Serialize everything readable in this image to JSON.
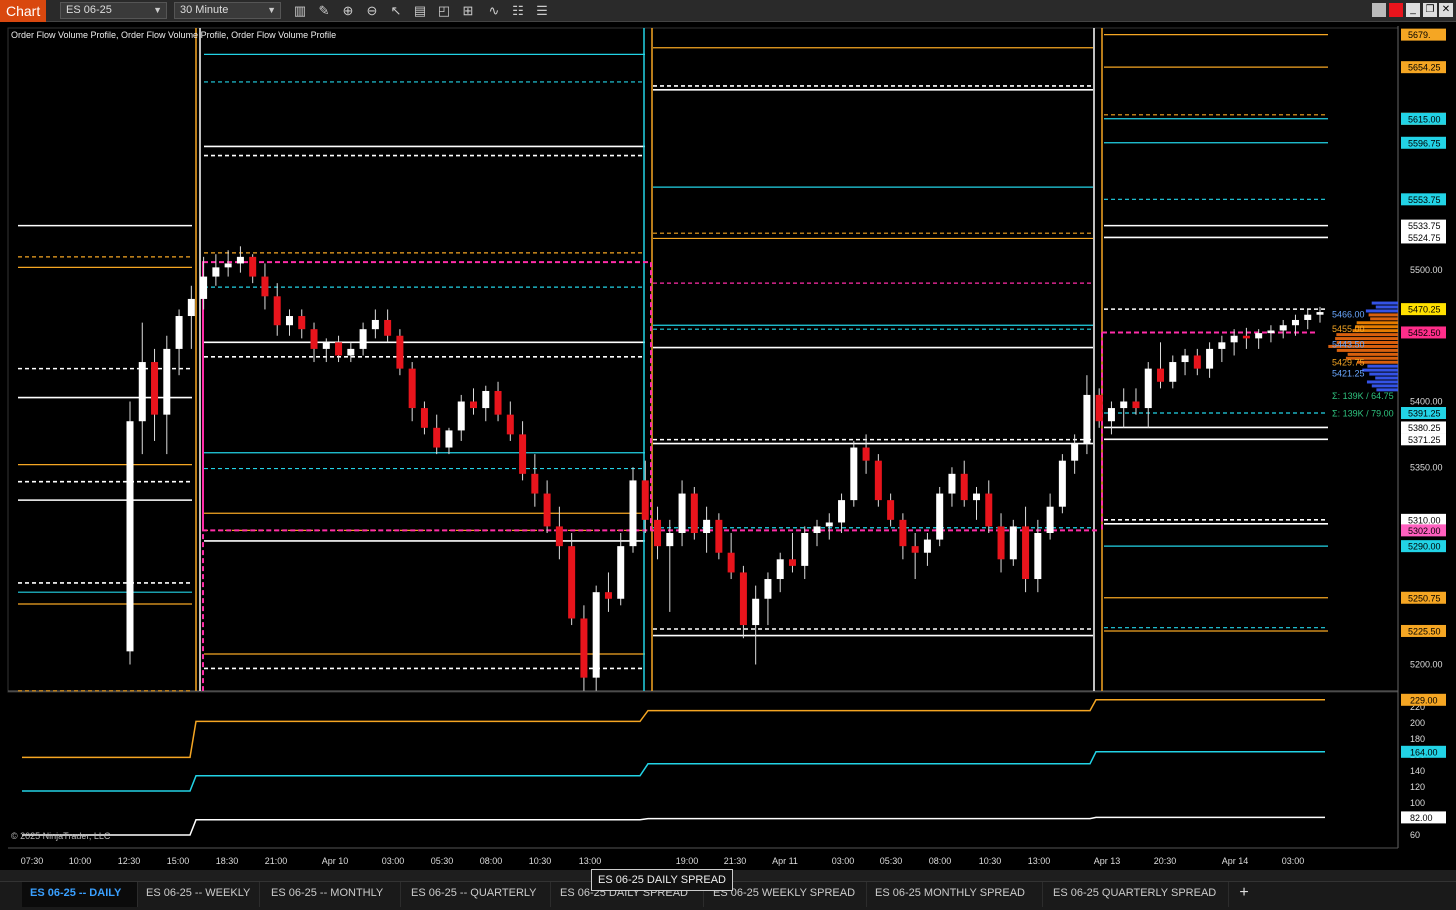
{
  "toolbar": {
    "title": "Chart",
    "instrument": "ES 06-25",
    "interval": "30 Minute",
    "icons": [
      "bar-type-icon",
      "draw-pencil-icon",
      "zoom-in-icon",
      "zoom-out-icon",
      "pointer-icon",
      "data-box-icon",
      "templates-icon",
      "strategies-icon",
      "indicators-icon",
      "properties-icon",
      "list-icon"
    ]
  },
  "indicator_label": "Order Flow Volume Profile, Order Flow Volume Profile, Order Flow Volume Profile",
  "copyright": "© 2025 NinjaTrader, LLC",
  "price_labels": [
    {
      "text": "5679.",
      "value": 5679,
      "color": "#f5a623"
    },
    {
      "text": "5654.25",
      "value": 5654.25,
      "color": "#f5a623"
    },
    {
      "text": "5615.00",
      "value": 5615,
      "color": "#f5a623"
    },
    {
      "text": "5615.00",
      "value": 5615,
      "color": "#22d3e6"
    },
    {
      "text": "5596.75",
      "value": 5596.75,
      "color": "#22d3e6"
    },
    {
      "text": "5553.75",
      "value": 5553.75,
      "color": "#22d3e6"
    },
    {
      "text": "5533.75",
      "value": 5533.75,
      "color": "#ffffff"
    },
    {
      "text": "5524.75",
      "value": 5524.75,
      "color": "#ffffff"
    },
    {
      "text": "5470.25",
      "value": 5470.25,
      "color": "#ffe000"
    },
    {
      "text": "5452.50",
      "value": 5452.5,
      "color": "#ff2d8a"
    },
    {
      "text": "5391.25",
      "value": 5391.25,
      "color": "#22d3e6"
    },
    {
      "text": "5380.25",
      "value": 5380.25,
      "color": "#ffffff"
    },
    {
      "text": "5371.25",
      "value": 5371.25,
      "color": "#ffffff"
    },
    {
      "text": "5310.00",
      "value": 5310,
      "color": "#ffffff"
    },
    {
      "text": "5302.00",
      "value": 5302,
      "color": "#ff5fbf"
    },
    {
      "text": "5290.00",
      "value": 5290,
      "color": "#22d3e6"
    },
    {
      "text": "5250.75",
      "value": 5250.75,
      "color": "#f5a623"
    },
    {
      "text": "5225.50",
      "value": 5225.5,
      "color": "#f5a623"
    }
  ],
  "price_ticks": [
    "5500.00",
    "5450.00",
    "5400.00",
    "5350.00",
    "5200.00"
  ],
  "profile_labels": [
    {
      "text": "5466.00",
      "color": "#6aa8ff"
    },
    {
      "text": "5455.00",
      "color": "#f5a623"
    },
    {
      "text": "5443.50",
      "color": "#6aa8ff"
    },
    {
      "text": "5429.75",
      "color": "#f5a623"
    },
    {
      "text": "5421.25",
      "color": "#6aa8ff"
    },
    {
      "text": "Σ: 139K / 64.75",
      "color": "#2ec27e"
    },
    {
      "text": "Σ: 139K / 79.00",
      "color": "#2ec27e"
    }
  ],
  "lower_panel": {
    "labels": [
      {
        "text": "229.00",
        "value": 229,
        "color": "#f5a623"
      },
      {
        "text": "164.00",
        "value": 164,
        "color": "#22d3e6"
      },
      {
        "text": "82.00",
        "value": 82,
        "color": "#ffffff"
      }
    ],
    "ticks": [
      "220",
      "200",
      "180",
      "160",
      "140",
      "120",
      "100",
      "80",
      "60"
    ]
  },
  "time_axis": [
    "07:30",
    "10:00",
    "12:30",
    "15:00",
    "18:30",
    "21:00",
    "Apr 10",
    "03:00",
    "05:30",
    "08:00",
    "10:30",
    "13:00",
    "19:00",
    "21:30",
    "Apr 11",
    "03:00",
    "05:30",
    "08:00",
    "10:30",
    "13:00",
    "Apr 13",
    "20:30",
    "Apr 14",
    "03:00"
  ],
  "tabs": [
    {
      "label": "ES 06-25 -- DAILY",
      "active": true
    },
    {
      "label": "ES 06-25 -- WEEKLY",
      "active": false
    },
    {
      "label": "ES 06-25 -- MONTHLY",
      "active": false
    },
    {
      "label": "ES 06-25 -- QUARTERLY",
      "active": false
    },
    {
      "label": "ES 06-25 DAILY SPREAD",
      "active": false
    },
    {
      "label": "ES 06-25 WEEKLY SPREAD",
      "active": false
    },
    {
      "label": "ES 06-25 MONTHLY SPREAD",
      "active": false
    },
    {
      "label": "ES 06-25 QUARTERLY SPREAD",
      "active": false
    }
  ],
  "tooltip": "ES 06-25 DAILY SPREAD",
  "colors": {
    "up": "#ffffff",
    "down": "#e8141c",
    "orange": "#f5a623",
    "cyan": "#22d3e6",
    "magenta": "#ff2da8",
    "white": "#ffffff",
    "background": "#000000"
  },
  "candles": [
    [
      5210,
      5400,
      5200,
      5385
    ],
    [
      5385,
      5460,
      5360,
      5430
    ],
    [
      5430,
      5440,
      5370,
      5390
    ],
    [
      5390,
      5450,
      5360,
      5440
    ],
    [
      5440,
      5470,
      5420,
      5465
    ],
    [
      5465,
      5488,
      5440,
      5478
    ],
    [
      5478,
      5510,
      5470,
      5495
    ],
    [
      5495,
      5512,
      5488,
      5502
    ],
    [
      5502,
      5515,
      5495,
      5505
    ],
    [
      5505,
      5518,
      5498,
      5510
    ],
    [
      5510,
      5512,
      5490,
      5495
    ],
    [
      5495,
      5505,
      5470,
      5480
    ],
    [
      5480,
      5490,
      5450,
      5458
    ],
    [
      5458,
      5470,
      5450,
      5465
    ],
    [
      5465,
      5470,
      5448,
      5455
    ],
    [
      5455,
      5460,
      5430,
      5440
    ],
    [
      5440,
      5448,
      5430,
      5445
    ],
    [
      5445,
      5450,
      5430,
      5435
    ],
    [
      5435,
      5445,
      5430,
      5440
    ],
    [
      5440,
      5460,
      5435,
      5455
    ],
    [
      5455,
      5470,
      5448,
      5462
    ],
    [
      5462,
      5470,
      5445,
      5450
    ],
    [
      5450,
      5455,
      5420,
      5425
    ],
    [
      5425,
      5430,
      5385,
      5395
    ],
    [
      5395,
      5400,
      5375,
      5380
    ],
    [
      5380,
      5390,
      5360,
      5365
    ],
    [
      5365,
      5380,
      5360,
      5378
    ],
    [
      5378,
      5405,
      5370,
      5400
    ],
    [
      5400,
      5410,
      5390,
      5395
    ],
    [
      5395,
      5412,
      5385,
      5408
    ],
    [
      5408,
      5415,
      5385,
      5390
    ],
    [
      5390,
      5400,
      5370,
      5375
    ],
    [
      5375,
      5385,
      5340,
      5345
    ],
    [
      5345,
      5360,
      5320,
      5330
    ],
    [
      5330,
      5340,
      5300,
      5305
    ],
    [
      5305,
      5320,
      5280,
      5290
    ],
    [
      5290,
      5300,
      5230,
      5235
    ],
    [
      5235,
      5245,
      5180,
      5190
    ],
    [
      5190,
      5260,
      5180,
      5255
    ],
    [
      5255,
      5270,
      5240,
      5250
    ],
    [
      5250,
      5300,
      5245,
      5290
    ],
    [
      5290,
      5350,
      5285,
      5340
    ],
    [
      5340,
      5355,
      5300,
      5310
    ],
    [
      5310,
      5320,
      5280,
      5290
    ],
    [
      5290,
      5310,
      5240,
      5300
    ],
    [
      5300,
      5340,
      5290,
      5330
    ],
    [
      5330,
      5335,
      5295,
      5300
    ],
    [
      5300,
      5320,
      5285,
      5310
    ],
    [
      5310,
      5315,
      5280,
      5285
    ],
    [
      5285,
      5300,
      5265,
      5270
    ],
    [
      5270,
      5275,
      5220,
      5230
    ],
    [
      5230,
      5260,
      5200,
      5250
    ],
    [
      5250,
      5270,
      5230,
      5265
    ],
    [
      5265,
      5285,
      5255,
      5280
    ],
    [
      5280,
      5300,
      5270,
      5275
    ],
    [
      5275,
      5305,
      5265,
      5300
    ],
    [
      5300,
      5310,
      5290,
      5305
    ],
    [
      5305,
      5315,
      5295,
      5308
    ],
    [
      5308,
      5330,
      5300,
      5325
    ],
    [
      5325,
      5370,
      5320,
      5365
    ],
    [
      5365,
      5375,
      5345,
      5355
    ],
    [
      5355,
      5360,
      5320,
      5325
    ],
    [
      5325,
      5330,
      5305,
      5310
    ],
    [
      5310,
      5315,
      5280,
      5290
    ],
    [
      5290,
      5300,
      5265,
      5285
    ],
    [
      5285,
      5300,
      5275,
      5295
    ],
    [
      5295,
      5335,
      5290,
      5330
    ],
    [
      5330,
      5350,
      5320,
      5345
    ],
    [
      5345,
      5355,
      5320,
      5325
    ],
    [
      5325,
      5335,
      5310,
      5330
    ],
    [
      5330,
      5340,
      5300,
      5305
    ],
    [
      5305,
      5315,
      5270,
      5280
    ],
    [
      5280,
      5310,
      5275,
      5305
    ],
    [
      5305,
      5320,
      5255,
      5265
    ],
    [
      5265,
      5310,
      5255,
      5300
    ],
    [
      5300,
      5330,
      5295,
      5320
    ],
    [
      5320,
      5360,
      5315,
      5355
    ],
    [
      5355,
      5375,
      5345,
      5368
    ],
    [
      5368,
      5420,
      5360,
      5405
    ],
    [
      5405,
      5410,
      5380,
      5385
    ],
    [
      5385,
      5400,
      5375,
      5395
    ],
    [
      5395,
      5410,
      5380,
      5400
    ],
    [
      5400,
      5410,
      5390,
      5395
    ],
    [
      5395,
      5430,
      5380,
      5425
    ],
    [
      5425,
      5445,
      5410,
      5415
    ],
    [
      5415,
      5435,
      5410,
      5430
    ],
    [
      5430,
      5440,
      5420,
      5435
    ],
    [
      5435,
      5440,
      5420,
      5425
    ],
    [
      5425,
      5445,
      5418,
      5440
    ],
    [
      5440,
      5450,
      5430,
      5445
    ],
    [
      5445,
      5455,
      5435,
      5450
    ],
    [
      5450,
      5456,
      5440,
      5448
    ],
    [
      5448,
      5455,
      5440,
      5452
    ],
    [
      5452,
      5458,
      5445,
      5454
    ],
    [
      5454,
      5462,
      5448,
      5458
    ],
    [
      5458,
      5466,
      5450,
      5462
    ],
    [
      5462,
      5470,
      5455,
      5466
    ],
    [
      5466,
      5472,
      5460,
      5468
    ]
  ]
}
